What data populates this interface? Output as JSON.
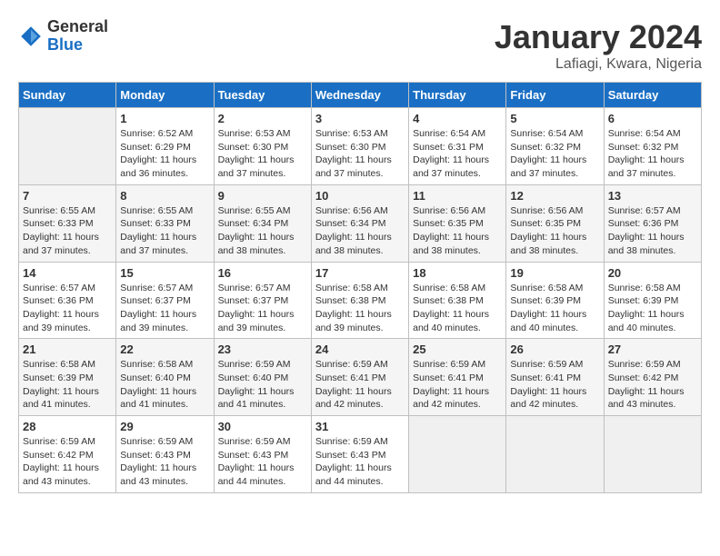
{
  "logo": {
    "general": "General",
    "blue": "Blue"
  },
  "title": "January 2024",
  "subtitle": "Lafiagi, Kwara, Nigeria",
  "columns": [
    "Sunday",
    "Monday",
    "Tuesday",
    "Wednesday",
    "Thursday",
    "Friday",
    "Saturday"
  ],
  "weeks": [
    [
      {
        "day": "",
        "sunrise": "",
        "sunset": "",
        "daylight": ""
      },
      {
        "day": "1",
        "sunrise": "6:52 AM",
        "sunset": "6:29 PM",
        "daylight": "11 hours and 36 minutes."
      },
      {
        "day": "2",
        "sunrise": "6:53 AM",
        "sunset": "6:30 PM",
        "daylight": "11 hours and 37 minutes."
      },
      {
        "day": "3",
        "sunrise": "6:53 AM",
        "sunset": "6:30 PM",
        "daylight": "11 hours and 37 minutes."
      },
      {
        "day": "4",
        "sunrise": "6:54 AM",
        "sunset": "6:31 PM",
        "daylight": "11 hours and 37 minutes."
      },
      {
        "day": "5",
        "sunrise": "6:54 AM",
        "sunset": "6:32 PM",
        "daylight": "11 hours and 37 minutes."
      },
      {
        "day": "6",
        "sunrise": "6:54 AM",
        "sunset": "6:32 PM",
        "daylight": "11 hours and 37 minutes."
      }
    ],
    [
      {
        "day": "7",
        "sunrise": "6:55 AM",
        "sunset": "6:33 PM",
        "daylight": "11 hours and 37 minutes."
      },
      {
        "day": "8",
        "sunrise": "6:55 AM",
        "sunset": "6:33 PM",
        "daylight": "11 hours and 37 minutes."
      },
      {
        "day": "9",
        "sunrise": "6:55 AM",
        "sunset": "6:34 PM",
        "daylight": "11 hours and 38 minutes."
      },
      {
        "day": "10",
        "sunrise": "6:56 AM",
        "sunset": "6:34 PM",
        "daylight": "11 hours and 38 minutes."
      },
      {
        "day": "11",
        "sunrise": "6:56 AM",
        "sunset": "6:35 PM",
        "daylight": "11 hours and 38 minutes."
      },
      {
        "day": "12",
        "sunrise": "6:56 AM",
        "sunset": "6:35 PM",
        "daylight": "11 hours and 38 minutes."
      },
      {
        "day": "13",
        "sunrise": "6:57 AM",
        "sunset": "6:36 PM",
        "daylight": "11 hours and 38 minutes."
      }
    ],
    [
      {
        "day": "14",
        "sunrise": "6:57 AM",
        "sunset": "6:36 PM",
        "daylight": "11 hours and 39 minutes."
      },
      {
        "day": "15",
        "sunrise": "6:57 AM",
        "sunset": "6:37 PM",
        "daylight": "11 hours and 39 minutes."
      },
      {
        "day": "16",
        "sunrise": "6:57 AM",
        "sunset": "6:37 PM",
        "daylight": "11 hours and 39 minutes."
      },
      {
        "day": "17",
        "sunrise": "6:58 AM",
        "sunset": "6:38 PM",
        "daylight": "11 hours and 39 minutes."
      },
      {
        "day": "18",
        "sunrise": "6:58 AM",
        "sunset": "6:38 PM",
        "daylight": "11 hours and 40 minutes."
      },
      {
        "day": "19",
        "sunrise": "6:58 AM",
        "sunset": "6:39 PM",
        "daylight": "11 hours and 40 minutes."
      },
      {
        "day": "20",
        "sunrise": "6:58 AM",
        "sunset": "6:39 PM",
        "daylight": "11 hours and 40 minutes."
      }
    ],
    [
      {
        "day": "21",
        "sunrise": "6:58 AM",
        "sunset": "6:39 PM",
        "daylight": "11 hours and 41 minutes."
      },
      {
        "day": "22",
        "sunrise": "6:58 AM",
        "sunset": "6:40 PM",
        "daylight": "11 hours and 41 minutes."
      },
      {
        "day": "23",
        "sunrise": "6:59 AM",
        "sunset": "6:40 PM",
        "daylight": "11 hours and 41 minutes."
      },
      {
        "day": "24",
        "sunrise": "6:59 AM",
        "sunset": "6:41 PM",
        "daylight": "11 hours and 42 minutes."
      },
      {
        "day": "25",
        "sunrise": "6:59 AM",
        "sunset": "6:41 PM",
        "daylight": "11 hours and 42 minutes."
      },
      {
        "day": "26",
        "sunrise": "6:59 AM",
        "sunset": "6:41 PM",
        "daylight": "11 hours and 42 minutes."
      },
      {
        "day": "27",
        "sunrise": "6:59 AM",
        "sunset": "6:42 PM",
        "daylight": "11 hours and 43 minutes."
      }
    ],
    [
      {
        "day": "28",
        "sunrise": "6:59 AM",
        "sunset": "6:42 PM",
        "daylight": "11 hours and 43 minutes."
      },
      {
        "day": "29",
        "sunrise": "6:59 AM",
        "sunset": "6:43 PM",
        "daylight": "11 hours and 43 minutes."
      },
      {
        "day": "30",
        "sunrise": "6:59 AM",
        "sunset": "6:43 PM",
        "daylight": "11 hours and 44 minutes."
      },
      {
        "day": "31",
        "sunrise": "6:59 AM",
        "sunset": "6:43 PM",
        "daylight": "11 hours and 44 minutes."
      },
      {
        "day": "",
        "sunrise": "",
        "sunset": "",
        "daylight": ""
      },
      {
        "day": "",
        "sunrise": "",
        "sunset": "",
        "daylight": ""
      },
      {
        "day": "",
        "sunrise": "",
        "sunset": "",
        "daylight": ""
      }
    ]
  ],
  "labels": {
    "sunrise_prefix": "Sunrise: ",
    "sunset_prefix": "Sunset: ",
    "daylight_prefix": "Daylight: "
  }
}
